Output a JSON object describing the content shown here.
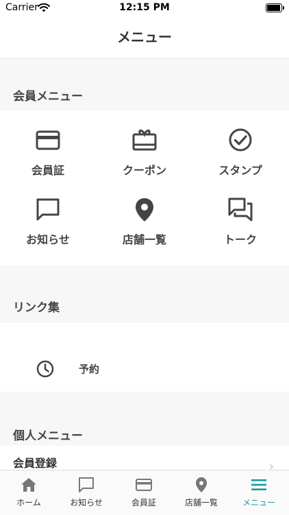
{
  "status_bar": {
    "carrier": "Carrier",
    "time": "12:15 PM"
  },
  "nav": {
    "title": "メニュー"
  },
  "sections": {
    "member": {
      "title": "会員メニュー"
    },
    "links": {
      "title": "リンク集"
    },
    "personal": {
      "title": "個人メニュー"
    }
  },
  "member_tiles": [
    {
      "label": "会員証",
      "icon": "card-icon"
    },
    {
      "label": "クーポン",
      "icon": "coupon-icon"
    },
    {
      "label": "スタンプ",
      "icon": "stamp-check-icon"
    },
    {
      "label": "お知らせ",
      "icon": "message-icon"
    },
    {
      "label": "店舗一覧",
      "icon": "location-pin-icon"
    },
    {
      "label": "トーク",
      "icon": "chat-icon"
    }
  ],
  "links": [
    {
      "label": "予約",
      "icon": "clock-icon"
    }
  ],
  "personal_items": [
    {
      "label": "会員登録"
    }
  ],
  "tabbar": {
    "active_color": "#1a9a9a",
    "items": [
      {
        "label": "ホーム",
        "icon": "home-icon"
      },
      {
        "label": "お知らせ",
        "icon": "message-icon"
      },
      {
        "label": "会員証",
        "icon": "card-icon"
      },
      {
        "label": "店舗一覧",
        "icon": "location-pin-icon"
      },
      {
        "label": "メニュー",
        "icon": "menu-icon",
        "active": true
      }
    ]
  }
}
